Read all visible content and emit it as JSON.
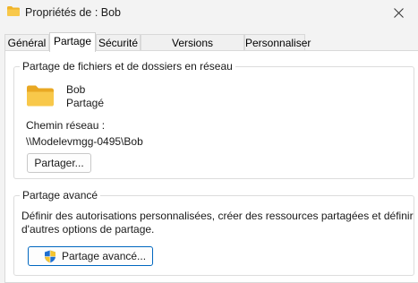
{
  "window": {
    "title": "Propriétés de : Bob",
    "title_icon": "folder-icon",
    "close_icon": "close-icon"
  },
  "tabs": [
    {
      "label": "Général"
    },
    {
      "label": "Partage",
      "active": true
    },
    {
      "label": "Sécurité"
    },
    {
      "label": "Versions précédentes"
    },
    {
      "label": "Personnaliser"
    }
  ],
  "network_sharing": {
    "group_title": "Partage de fichiers et de dossiers en réseau",
    "folder_icon": "folder-icon",
    "folder_name": "Bob",
    "folder_status": "Partagé",
    "network_path_label": "Chemin réseau :",
    "network_path": "\\\\Modelevmgg-0495\\Bob",
    "share_button": "Partager..."
  },
  "advanced_sharing": {
    "group_title": "Partage avancé",
    "description_line1": "Définir des autorisations personnalisées, créer des ressources partagées et définir",
    "description_line2": "d'autres options de partage.",
    "button": "Partage avancé...",
    "button_icon": "uac-shield-icon"
  },
  "colors": {
    "window_bg": "#f3f3f3",
    "panel_bg": "#ffffff",
    "folder_yellow": "#f8c84a",
    "accent_border": "#0067c0"
  }
}
